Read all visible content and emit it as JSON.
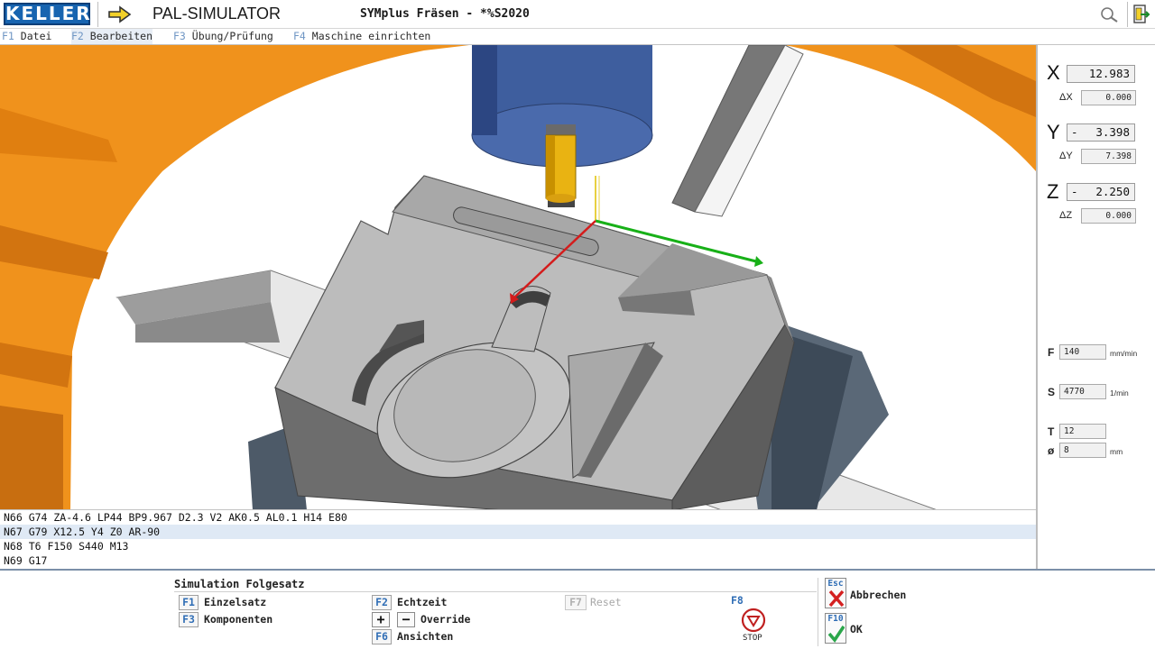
{
  "titlebar": {
    "logo_text": "KELLER",
    "app_title": "PAL-SIMULATOR",
    "doc_title": "SYMplus Fräsen - *%S2020"
  },
  "menu": [
    {
      "key": "F1",
      "label": "Datei"
    },
    {
      "key": "F2",
      "label": "Bearbeiten"
    },
    {
      "key": "F3",
      "label": "Übung/Prüfung"
    },
    {
      "key": "F4",
      "label": "Maschine einrichten"
    }
  ],
  "axes": {
    "x": {
      "label": "X",
      "sign": "",
      "value": "12.983",
      "delta_label": "ΔX",
      "delta": "0.000"
    },
    "y": {
      "label": "Y",
      "sign": "-",
      "value": "3.398",
      "delta_label": "ΔY",
      "delta": "7.398"
    },
    "z": {
      "label": "Z",
      "sign": "-",
      "value": "2.250",
      "delta_label": "ΔZ",
      "delta": "0.000"
    }
  },
  "params": {
    "feed": {
      "label": "F",
      "value": "140",
      "unit": "mm/min"
    },
    "speed": {
      "label": "S",
      "value": "4770",
      "unit": "1/min"
    },
    "tool": {
      "label": "T",
      "value": "12"
    },
    "diameter": {
      "label": "ø",
      "value": "8",
      "unit": "mm"
    }
  },
  "program_lines": [
    "N66 G74 ZA-4.6 LP44 BP9.967 D2.3 V2 AK0.5 AL0.1 H14 E80",
    "N67 G79 X12.5 Y4 Z0 AR-90",
    "N68 T6 F150 S440 M13",
    "N69 G17"
  ],
  "simulation": {
    "title": "Simulation Folgesatz",
    "f1_key": "F1",
    "f1_label": "Einzelsatz",
    "f3_key": "F3",
    "f3_label": "Komponenten",
    "f2_key": "F2",
    "f2_label": "Echtzeit",
    "plus": "+",
    "minus": "−",
    "override_label": "Override",
    "f6_key": "F6",
    "f6_label": "Ansichten",
    "f7_key": "F7",
    "f7_label": "Reset",
    "f8_key": "F8",
    "stop_label": "STOP"
  },
  "actions": {
    "esc_key": "Esc",
    "esc_label": "Abbrechen",
    "f10_key": "F10",
    "f10_label": "OK"
  },
  "colors": {
    "logo_blue": "#1764b0",
    "fkey_blue": "#2f6db5",
    "orange": "#f0921c",
    "workpiece_gray": "#b0b0b0",
    "spindle_blue": "#3e5e9e",
    "tool_yellow": "#e9b312",
    "x_axis_red": "#d41c1c",
    "y_axis_green": "#18b018",
    "cancel_red": "#d42020",
    "ok_green": "#2aa64a"
  }
}
